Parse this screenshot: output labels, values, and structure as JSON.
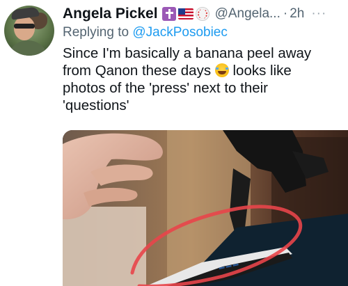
{
  "tweet": {
    "display_name": "Angela Pickel",
    "badges": [
      "cross-emoji",
      "us-flag-emoji",
      "baseball-emoji"
    ],
    "handle": "@Angela...",
    "separator": "·",
    "time": "2h",
    "more": "···",
    "reply_prefix": "Replying to",
    "reply_mention": "@JackPosobiec",
    "text_lines": [
      "Since I'm basically a banana peel away",
      "from Qanon these days",
      "looks like",
      "photos of the 'press' next to their",
      "'questions'"
    ],
    "text_emoji": "rolling-on-floor-laughing-emoji"
  },
  "colors": {
    "text": "#0f1419",
    "secondary": "#536471",
    "link": "#1d9bf0",
    "highlight_circle": "#e8454a"
  }
}
